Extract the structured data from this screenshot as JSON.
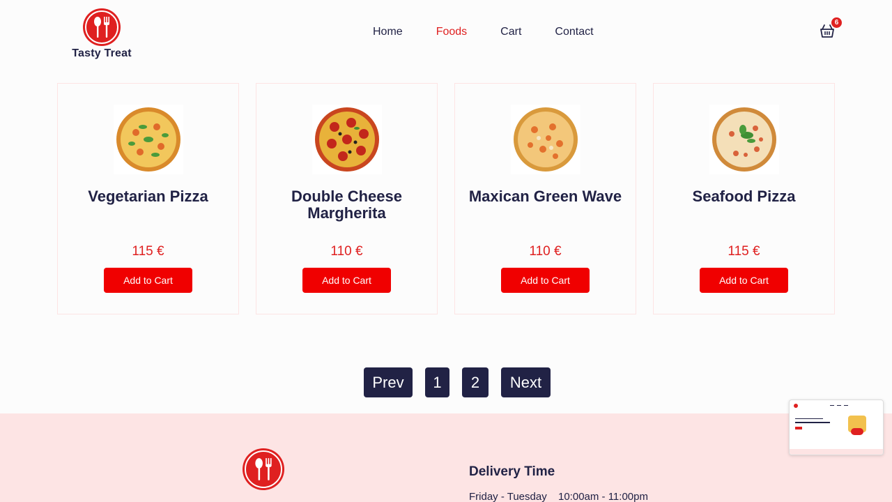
{
  "brand": {
    "name": "Tasty Treat",
    "logo_icon": "spoon-fork-icon",
    "accent": "#df2020",
    "dark": "#212245"
  },
  "nav": {
    "items": [
      {
        "label": "Home",
        "active": false
      },
      {
        "label": "Foods",
        "active": true
      },
      {
        "label": "Cart",
        "active": false
      },
      {
        "label": "Contact",
        "active": false
      }
    ]
  },
  "cart": {
    "icon": "shopping-basket-icon",
    "count": "6"
  },
  "products": [
    {
      "title": "Vegetarian Pizza",
      "price": "115 €",
      "button": "Add to Cart",
      "image": "vegetarian-pizza"
    },
    {
      "title": "Double Cheese Margherita",
      "price": "110 €",
      "button": "Add to Cart",
      "image": "pepperoni-pizza"
    },
    {
      "title": "Maxican Green Wave",
      "price": "110 €",
      "button": "Add to Cart",
      "image": "maxican-pizza"
    },
    {
      "title": "Seafood Pizza",
      "price": "115 €",
      "button": "Add to Cart",
      "image": "seafood-pizza"
    }
  ],
  "pagination": {
    "prev": "Prev",
    "pages": [
      "1",
      "2"
    ],
    "next": "Next"
  },
  "footer": {
    "delivery_title": "Delivery Time",
    "delivery_days": "Friday - Tuesday",
    "delivery_hours": "10:00am - 11:00pm"
  }
}
